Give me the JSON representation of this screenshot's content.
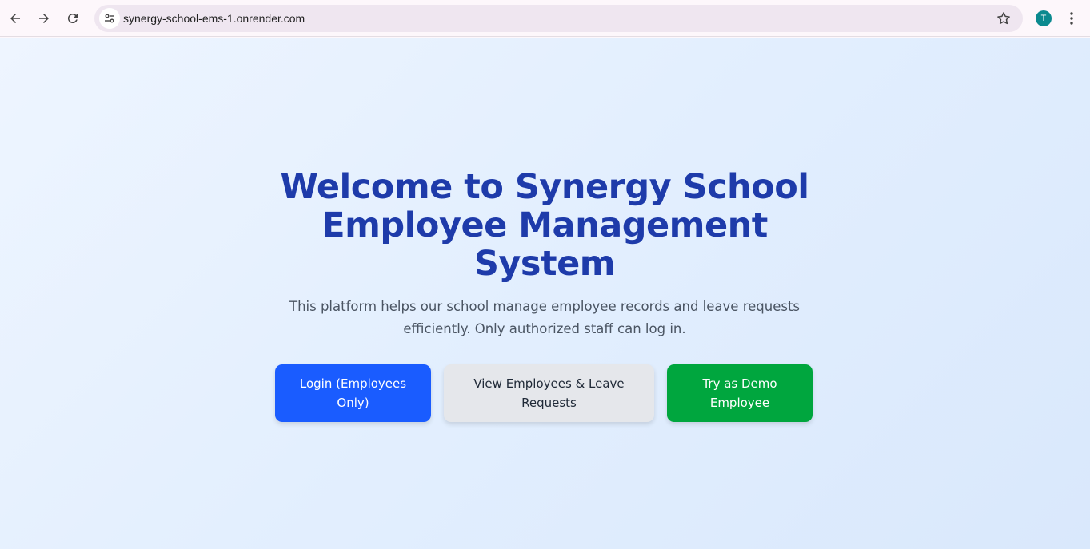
{
  "browser": {
    "url": "synergy-school-ems-1.onrender.com",
    "profile_initial": "T",
    "icons": [
      "back-icon",
      "forward-icon",
      "reload-icon",
      "site-info-icon",
      "bookmark-star-icon",
      "more-vert-icon"
    ]
  },
  "hero": {
    "title": "Welcome to Synergy School Employee Management System",
    "description": "This platform helps our school manage employee records and leave requests efficiently. Only authorized staff can log in."
  },
  "actions": {
    "login_label": "Login (Employees Only)",
    "view_label": "View Employees & Leave Requests",
    "demo_label": "Try as Demo Employee"
  },
  "colors": {
    "title": "#1e3baa",
    "login_button": "#1a5cff",
    "view_button": "#e5e7eb",
    "demo_button": "#00a63e",
    "avatar": "#0b8a8f"
  }
}
